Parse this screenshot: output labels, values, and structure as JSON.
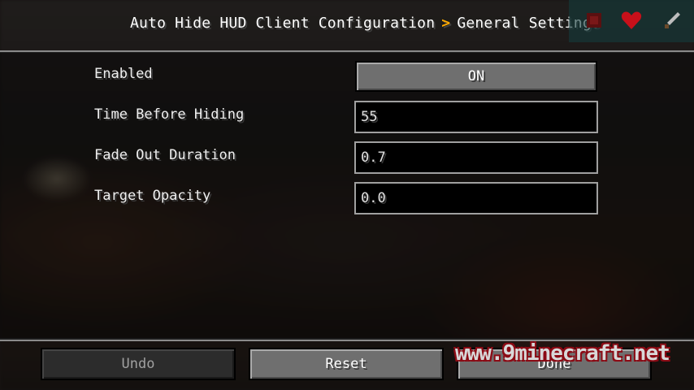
{
  "header": {
    "breadcrumb_parent": "Auto Hide HUD Client Configuration",
    "breadcrumb_separator": ">",
    "breadcrumb_current": "General Settings"
  },
  "settings": [
    {
      "label": "Enabled",
      "type": "toggle",
      "value": "ON"
    },
    {
      "label": "Time Before Hiding",
      "type": "text",
      "value": "55"
    },
    {
      "label": "Fade Out Duration",
      "type": "text",
      "value": "0.7"
    },
    {
      "label": "Target Opacity",
      "type": "text",
      "value": "0.0"
    }
  ],
  "footer": {
    "undo_label": "Undo",
    "reset_label": "Reset",
    "done_label": "Done"
  },
  "watermark": "www.9minecraft.net",
  "hud_icons": [
    "armor-icon",
    "heart-icon",
    "sword-icon"
  ],
  "colors": {
    "breadcrumb_separator": "#ffaa00",
    "button_bg": "#6f6f6f",
    "input_bg": "#000000",
    "input_border": "#a0a0a0",
    "watermark_outline": "#8b0a14"
  }
}
